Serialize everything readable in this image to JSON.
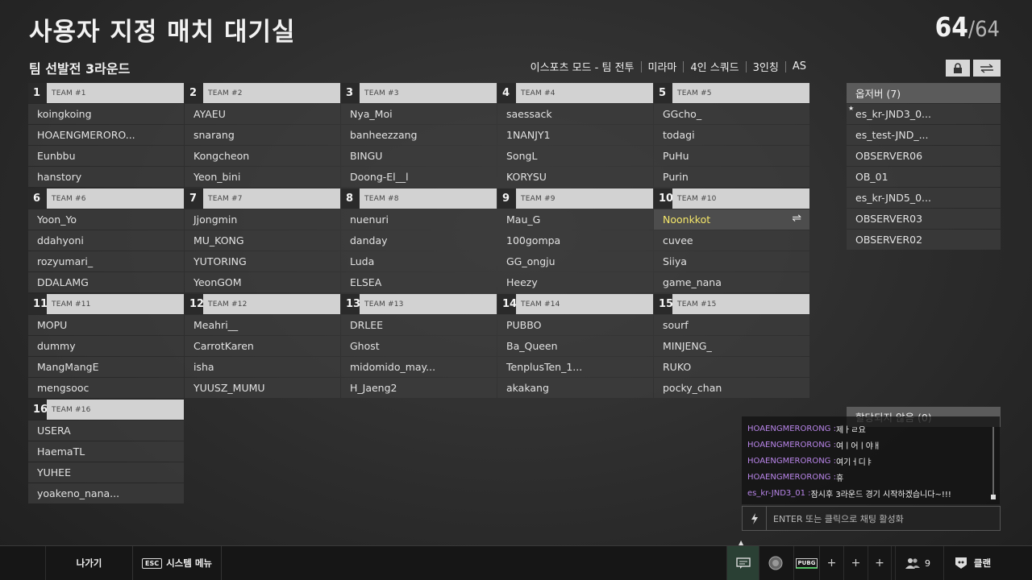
{
  "header": {
    "title": "사용자 지정 매치 대기실",
    "count_current": "64",
    "count_max": "/64",
    "subtitle": "팀 선발전 3라운드",
    "modes": [
      "이스포츠 모드 - 팀 전투",
      "미라마",
      "4인 스쿼드",
      "3인칭",
      "AS"
    ],
    "lock_icon": "lock-icon",
    "swap_icon": "swap-icon"
  },
  "teams": [
    {
      "num": "1",
      "label": "TEAM #1",
      "players": [
        "koingkoing",
        "HOAENGMERORO...",
        "Eunbbu",
        "hanstory"
      ]
    },
    {
      "num": "2",
      "label": "TEAM #2",
      "players": [
        "AYAEU",
        "snarang",
        "Kongcheon",
        "Yeon_bini"
      ]
    },
    {
      "num": "3",
      "label": "TEAM #3",
      "players": [
        "Nya_Moi",
        "banheezzang",
        "BINGU",
        "Doong-El__l"
      ]
    },
    {
      "num": "4",
      "label": "TEAM #4",
      "players": [
        "saessack",
        "1NANJY1",
        "SongL",
        "KORYSU"
      ]
    },
    {
      "num": "5",
      "label": "TEAM #5",
      "players": [
        "GGcho_",
        "todagi",
        "PuHu",
        "Purin"
      ]
    },
    {
      "num": "6",
      "label": "TEAM #6",
      "players": [
        "Yoon_Yo",
        "ddahyoni",
        "rozyumari_",
        "DDALAMG"
      ]
    },
    {
      "num": "7",
      "label": "TEAM #7",
      "players": [
        "Jjongmin",
        "MU_KONG",
        "YUTORING",
        "YeonGOM"
      ]
    },
    {
      "num": "8",
      "label": "TEAM #8",
      "players": [
        "nuenuri",
        "danday",
        "Luda",
        "ELSEA"
      ]
    },
    {
      "num": "9",
      "label": "TEAM #9",
      "players": [
        "Mau_G",
        "100gompa",
        "GG_ongju",
        "Heezy"
      ]
    },
    {
      "num": "10",
      "label": "TEAM #10",
      "players": [
        "Noonkkot",
        "cuvee",
        "Siiya",
        "game_nana"
      ]
    },
    {
      "num": "11",
      "label": "TEAM #11",
      "players": [
        "MOPU",
        "dummy",
        "MangMangE",
        "mengsooc"
      ]
    },
    {
      "num": "12",
      "label": "TEAM #12",
      "players": [
        "Meahri__",
        "CarrotKaren",
        "isha",
        "YUUSZ_MUMU"
      ]
    },
    {
      "num": "13",
      "label": "TEAM #13",
      "players": [
        "DRLEE",
        "Ghost",
        "midomido_may...",
        "H_Jaeng2"
      ]
    },
    {
      "num": "14",
      "label": "TEAM #14",
      "players": [
        "PUBBO",
        "Ba_Queen",
        "TenplusTen_1...",
        "akakang"
      ]
    },
    {
      "num": "15",
      "label": "TEAM #15",
      "players": [
        "sourf",
        "MINJENG_",
        "RUKO",
        "pocky_chan"
      ]
    },
    {
      "num": "16",
      "label": "TEAM #16",
      "players": [
        "USERA",
        "HaemaTL",
        "YUHEE",
        "yoakeno_nana..."
      ]
    }
  ],
  "observers": {
    "header": "옵저버 (7)",
    "items": [
      "es_kr-JND3_0...",
      "es_test-JND_...",
      "OBSERVER06",
      "OB_01",
      "es_kr-JND5_0...",
      "OBSERVER03",
      "OBSERVER02"
    ]
  },
  "unassigned": "할당되지 않음 (0)",
  "chat": {
    "lines": [
      {
        "who": "HOAENGMERORONG : ",
        "msg": "제ㅏㄹ요"
      },
      {
        "who": "HOAENGMERORONG : ",
        "msg": "여ㅣ어ㅣ야ㅐ"
      },
      {
        "who": "HOAENGMERORONG : ",
        "msg": "여기ㅓ디ㅑ"
      },
      {
        "who": "HOAENGMERORONG : ",
        "msg": "휴"
      },
      {
        "who": "es_kr-JND3_01 : ",
        "msg": "잠시후 3라운드 경기 시작하겠습니다~!!!"
      }
    ],
    "input_placeholder": "ENTER 또는 클릭으로 채팅 활성화"
  },
  "bottombar": {
    "exit_label": "나가기",
    "esc_key": "ESC",
    "system_menu_label": "시스템 메뉴",
    "pubg_label": "PUBG",
    "friends_count": "9",
    "clan_label": "클랜"
  },
  "colors": {
    "highlight_name": "#f5e76a",
    "chat_name": "#b985ea",
    "team_label_bg": "#d2d2d2"
  }
}
